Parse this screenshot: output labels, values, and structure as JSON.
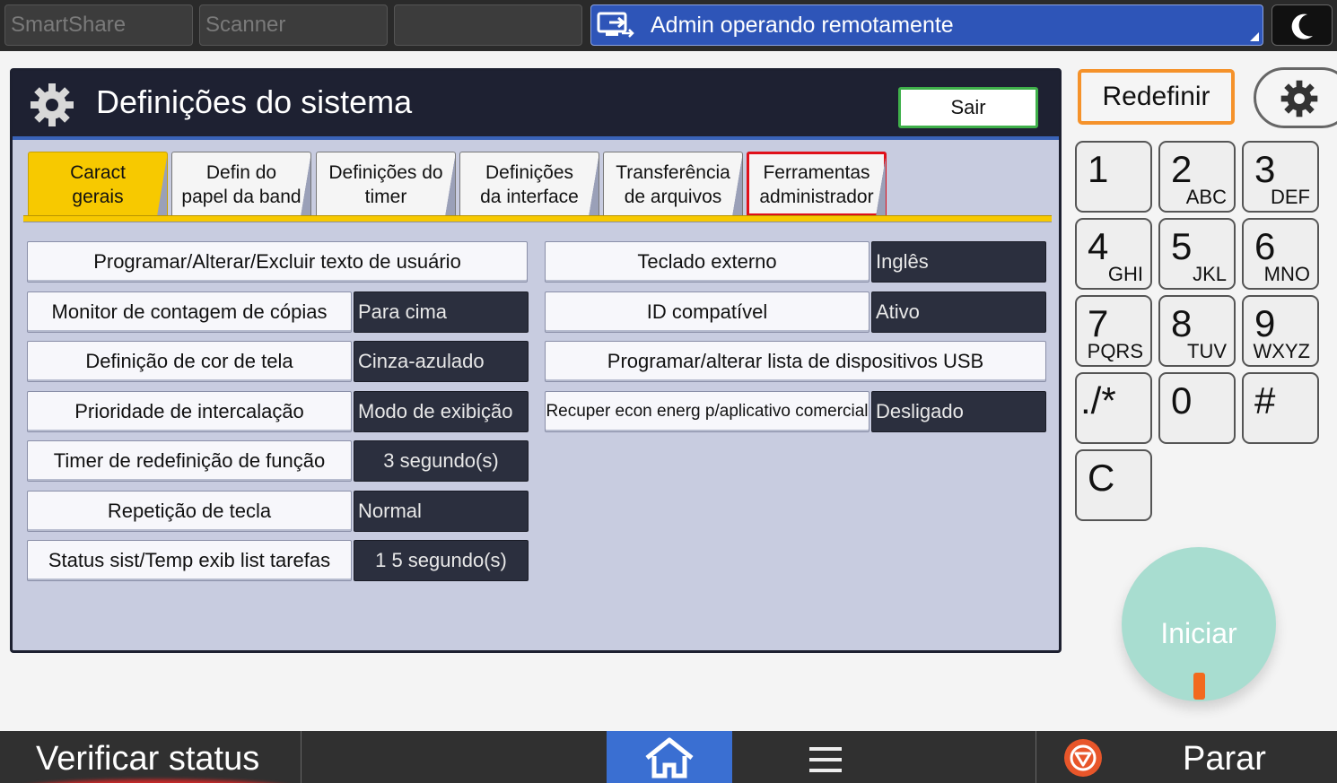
{
  "topbar": {
    "tabs": [
      "SmartShare",
      "Scanner",
      ""
    ],
    "remote_banner": "Admin operando remotamente"
  },
  "panel": {
    "title": "Definições do sistema",
    "exit_label": "Sair",
    "tabs": [
      {
        "line1": "Caract",
        "line2": "gerais"
      },
      {
        "line1": "Defin do",
        "line2": "papel da band"
      },
      {
        "line1": "Definições do",
        "line2": "timer"
      },
      {
        "line1": "Definições",
        "line2": "da interface"
      },
      {
        "line1": "Transferência",
        "line2": "de arquivos"
      },
      {
        "line1": "Ferramentas",
        "line2": "administrador"
      }
    ],
    "left_rows": [
      {
        "label": "Programar/Alterar/Excluir texto de usuário",
        "value": ""
      },
      {
        "label": "Monitor de contagem de cópias",
        "value": "Para cima"
      },
      {
        "label": "Definição de cor de tela",
        "value": "Cinza-azulado"
      },
      {
        "label": "Prioridade de intercalação",
        "value": "Modo de exibição"
      },
      {
        "label": "Timer de redefinição de função",
        "value": "3 segundo(s)"
      },
      {
        "label": "Repetição de tecla",
        "value": "Normal"
      },
      {
        "label": "Status sist/Temp exib list tarefas",
        "value": "1 5 segundo(s)"
      }
    ],
    "right_rows": [
      {
        "label": "Teclado externo",
        "value": "Inglês"
      },
      {
        "label": "ID compatível",
        "value": "Ativo"
      },
      {
        "label": "Programar/alterar lista de dispositivos USB",
        "value": ""
      },
      {
        "label": "Recuper econ energ p/aplicativo comercial",
        "value": "Desligado"
      }
    ]
  },
  "side": {
    "reset_label": "Redefinir",
    "keys": [
      {
        "num": "1",
        "sub": ""
      },
      {
        "num": "2",
        "sub": "ABC"
      },
      {
        "num": "3",
        "sub": "DEF"
      },
      {
        "num": "4",
        "sub": "GHI"
      },
      {
        "num": "5",
        "sub": "JKL"
      },
      {
        "num": "6",
        "sub": "MNO"
      },
      {
        "num": "7",
        "sub": "PQRS"
      },
      {
        "num": "8",
        "sub": "TUV"
      },
      {
        "num": "9",
        "sub": "WXYZ"
      },
      {
        "num": "./*",
        "sub": ""
      },
      {
        "num": "0",
        "sub": ""
      },
      {
        "num": "#",
        "sub": ""
      },
      {
        "num": "C",
        "sub": ""
      }
    ],
    "start_label": "Iniciar"
  },
  "bottombar": {
    "status_label": "Verificar status",
    "stop_label": "Parar"
  },
  "colors": {
    "accent_tab": "#f7c900",
    "remote_banner": "#2e55b8",
    "highlight": "#e0101a",
    "reset_border": "#f5922a",
    "exit_border": "#3fb04a",
    "start": "#a8ddd0",
    "home": "#3a6fd2"
  }
}
